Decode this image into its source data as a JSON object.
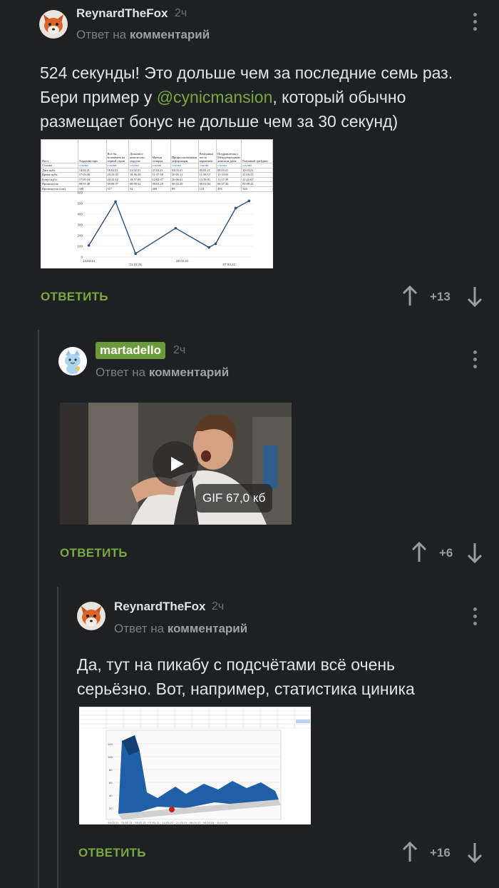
{
  "comments": [
    {
      "username": "ReynardTheFox",
      "time": "2ч",
      "reply_prefix": "Ответ на",
      "reply_target": "комментарий",
      "text_before": "524 секунды! Это дольше чем за последние семь раз. Бери пример у ",
      "mention": "@cynicmansion",
      "text_after": ", который обычно размещает бонус не дольше чем за 30 секунд)",
      "reply_label": "ОТВЕТИТЬ",
      "rating": "+13"
    },
    {
      "username": "martadello",
      "time": "2ч",
      "reply_prefix": "Ответ на",
      "reply_target": "комментарий",
      "gif_label": "GIF 67,0 кб",
      "reply_label": "ОТВЕТИТЬ",
      "rating": "+6"
    },
    {
      "username": "ReynardTheFox",
      "time": "2ч",
      "reply_prefix": "Ответ на",
      "reply_target": "комментарий",
      "text": "Да, тут на пикабу с подсчётами всё очень серьёзно. Вот, например, статистика циника",
      "reply_label": "ОТВЕТИТЬ",
      "rating": "+16"
    }
  ],
  "spreadsheet1": {
    "headers": [
      "Пост",
      "Хорошая пара",
      "Все бы вспомнить на первой серии",
      "Дольнеют количество упругие",
      "Мягкая отпирка",
      "Профессиональная деформация",
      "Вечеринка после карантина",
      "Поздравления с Международным женским днем",
      "Разумный трейдинг"
    ],
    "rows": [
      [
        "Ссылка",
        "ссылка",
        "ссылка",
        "ссылка",
        "ссылка",
        "ссылка",
        "ссылка",
        "ссылка",
        "ссылка"
      ],
      [
        "Дата публ.",
        "14.02.21",
        "18.02.21",
        "21.02.21",
        "27.02.21",
        "04.03.21",
        "05.03.21",
        "08.03.21",
        "10.03.21"
      ],
      [
        "Время публ.",
        "17:03:46",
        "20:23:35",
        "18:56:28",
        "11:57:38",
        "20:05:12",
        "11:58:57",
        "11:10:03",
        "21:16:23"
      ],
      [
        "Бонус публ.",
        "17:05:34",
        "20:32:12",
        "18:57:00",
        "12:02:07",
        "20:06:41",
        "13:58:01",
        "11:17:39",
        "21:25:07"
      ],
      [
        "Промежуток",
        "00:01:48",
        "00:08:37",
        "00:00:32",
        "00:04:29",
        "00:03:29",
        "00:02:04",
        "00:07:36",
        "00:08:44"
      ],
      [
        "Промежуток (сек)",
        "108",
        "517",
        "32",
        "269",
        "89",
        "124",
        "456",
        "524"
      ]
    ]
  },
  "chart_data": {
    "type": "line",
    "x": [
      "14.02.21",
      "18.02.21",
      "21.02.21",
      "27.02.21",
      "04.03.21",
      "05.03.21",
      "08.03.21",
      "10.03.21"
    ],
    "values": [
      108,
      517,
      32,
      269,
      89,
      124,
      456,
      524
    ],
    "xticks": [
      "14.02.21",
      "21.02.21",
      "28.02.21",
      "07.03.21"
    ],
    "yticks": [
      "0",
      "100",
      "200",
      "300",
      "400",
      "500",
      "600"
    ],
    "ylim": [
      0,
      600
    ],
    "line_color": "#2b4f7e"
  },
  "colors": {
    "background": "#1e2021",
    "accent": "#79a842",
    "badge": "#6b9a3a"
  },
  "icons": [
    "fox-avatar-icon",
    "cat-avatar-icon",
    "more-icon",
    "arrow-up-icon",
    "arrow-down-icon",
    "play-icon"
  ]
}
